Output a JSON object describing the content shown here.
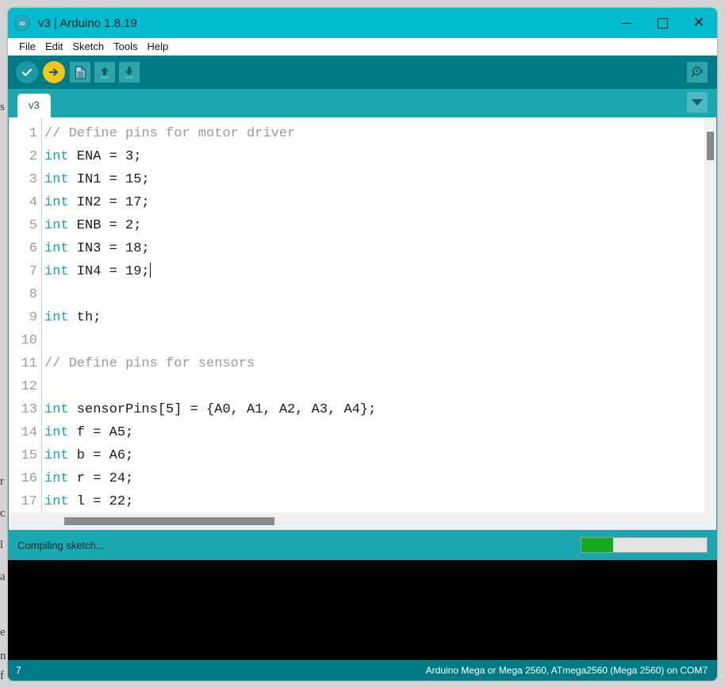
{
  "window": {
    "title": "v3 | Arduino 1.8.19",
    "logo_icon": "arduino-infinity-logo",
    "controls": {
      "minimize": "minimize-icon",
      "maximize": "maximize-icon",
      "close": "close-icon"
    }
  },
  "menubar": {
    "items": [
      {
        "label": "File"
      },
      {
        "label": "Edit"
      },
      {
        "label": "Sketch"
      },
      {
        "label": "Tools"
      },
      {
        "label": "Help"
      }
    ]
  },
  "toolbar": {
    "verify": {
      "icon": "checkmark-icon",
      "glyph": "✔",
      "color": "#1b9aa3"
    },
    "upload": {
      "icon": "right-arrow-icon",
      "glyph": "➜",
      "color": "#f5c518"
    },
    "new": {
      "icon": "new-file-icon"
    },
    "open": {
      "icon": "up-arrow-icon",
      "glyph": "⬆"
    },
    "save": {
      "icon": "down-arrow-icon",
      "glyph": "⬇"
    },
    "serial_monitor": {
      "icon": "magnifier-icon",
      "glyph": "⚲"
    }
  },
  "tabs": {
    "active": "v3",
    "items": [
      {
        "label": "v3"
      }
    ],
    "dropdown_icon": "chevron-down-icon"
  },
  "editor": {
    "lines": [
      {
        "num": "1",
        "segments": [
          {
            "text": "// Define pins for motor driver",
            "cls": "com"
          }
        ]
      },
      {
        "num": "2",
        "segments": [
          {
            "text": "int",
            "cls": "kw"
          },
          {
            "text": " ENA = 3;",
            "cls": ""
          }
        ]
      },
      {
        "num": "3",
        "segments": [
          {
            "text": "int",
            "cls": "kw"
          },
          {
            "text": " IN1 = 15;",
            "cls": ""
          }
        ]
      },
      {
        "num": "4",
        "segments": [
          {
            "text": "int",
            "cls": "kw"
          },
          {
            "text": " IN2 = 17;",
            "cls": ""
          }
        ]
      },
      {
        "num": "5",
        "segments": [
          {
            "text": "int",
            "cls": "kw"
          },
          {
            "text": " ENB = 2;",
            "cls": ""
          }
        ]
      },
      {
        "num": "6",
        "segments": [
          {
            "text": "int",
            "cls": "kw"
          },
          {
            "text": " IN3 = 18;",
            "cls": ""
          }
        ]
      },
      {
        "num": "7",
        "segments": [
          {
            "text": "int",
            "cls": "kw"
          },
          {
            "text": " IN4 = 19;",
            "cls": ""
          }
        ],
        "caret": true
      },
      {
        "num": "8",
        "segments": []
      },
      {
        "num": "9",
        "segments": [
          {
            "text": "int",
            "cls": "kw"
          },
          {
            "text": " th;",
            "cls": ""
          }
        ]
      },
      {
        "num": "10",
        "segments": []
      },
      {
        "num": "11",
        "segments": [
          {
            "text": "// Define pins for sensors",
            "cls": "com"
          }
        ]
      },
      {
        "num": "12",
        "segments": []
      },
      {
        "num": "13",
        "segments": [
          {
            "text": "int",
            "cls": "kw"
          },
          {
            "text": " sensorPins[5] = {A0, A1, A2, A3, A4};",
            "cls": ""
          }
        ]
      },
      {
        "num": "14",
        "segments": [
          {
            "text": "int",
            "cls": "kw"
          },
          {
            "text": " f = A5;",
            "cls": ""
          }
        ]
      },
      {
        "num": "15",
        "segments": [
          {
            "text": "int",
            "cls": "kw"
          },
          {
            "text": " b = A6;",
            "cls": ""
          }
        ]
      },
      {
        "num": "16",
        "segments": [
          {
            "text": "int",
            "cls": "kw"
          },
          {
            "text": " r = 24;",
            "cls": ""
          }
        ]
      },
      {
        "num": "17",
        "segments": [
          {
            "text": "int",
            "cls": "kw"
          },
          {
            "text": " l = 22;",
            "cls": ""
          }
        ]
      }
    ]
  },
  "status": {
    "message": "Compiling sketch...",
    "progress_percent": 25,
    "progress_color": "#13aa20"
  },
  "console": {
    "lines": []
  },
  "bottombar": {
    "cursor_line": "7",
    "board_info": "Arduino Mega or Mega 2560, ATmega2560 (Mega 2560) on COM7"
  },
  "background": {
    "fragments": [
      "s",
      "r",
      "c",
      "l",
      "a",
      "e",
      "n",
      "f"
    ]
  }
}
